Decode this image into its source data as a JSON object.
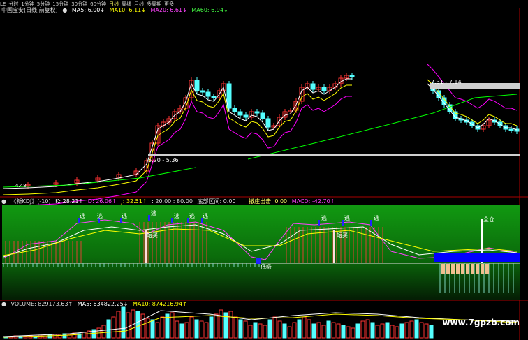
{
  "toolbar": {
    "items": [
      "LE",
      "分时",
      "1分钟",
      "5分钟",
      "15分钟",
      "30分钟",
      "60分钟",
      "日线",
      "周线",
      "月线",
      "多周期",
      "更多"
    ],
    "active_index": 7
  },
  "main_panel": {
    "stock": "中国宝安(日线,前复权)",
    "ma5": "MA5: 6.00↓",
    "ma10": "MA10: 6.11↓",
    "ma20": "MA20: 6.61↓",
    "ma60": "MA60: 6.94↓",
    "level_upper": "7.31 - 7.14",
    "level_lower": "5.20 - 5.36",
    "bottom_price": "4.48",
    "colors": {
      "ma5": "#ffffff",
      "ma10": "#ffff00",
      "ma20": "#ff00ff",
      "ma60": "#00ff00",
      "up": "#ff3333",
      "down": "#54ffff"
    }
  },
  "kdj_panel": {
    "name": "《新KDJ》(-10)",
    "k": "K: 28.21↑",
    "d": "D: 26.06↑",
    "j": "J: 32.51↑",
    "levels": ": 20.00 : 80.00",
    "bottom_zone": "底部区间: 0.00",
    "main_exit": "撤庄出击: 0.00",
    "macd": "MACD: -42.70↑",
    "tags": [
      "逃",
      "逃",
      "逃",
      "逃",
      "逃",
      "逃",
      "逃",
      "逃",
      "逃",
      "逃"
    ],
    "short_buy": [
      "短买",
      "短买"
    ],
    "low_buy": "低吸",
    "full_position": "全仓"
  },
  "volume_panel": {
    "volume": "VOLUME: 829173.63↑",
    "ma5": "MA5: 634822.25↓",
    "ma10": "MA10: 874216.94↑"
  },
  "watermark": "www.7gpzb.com"
}
